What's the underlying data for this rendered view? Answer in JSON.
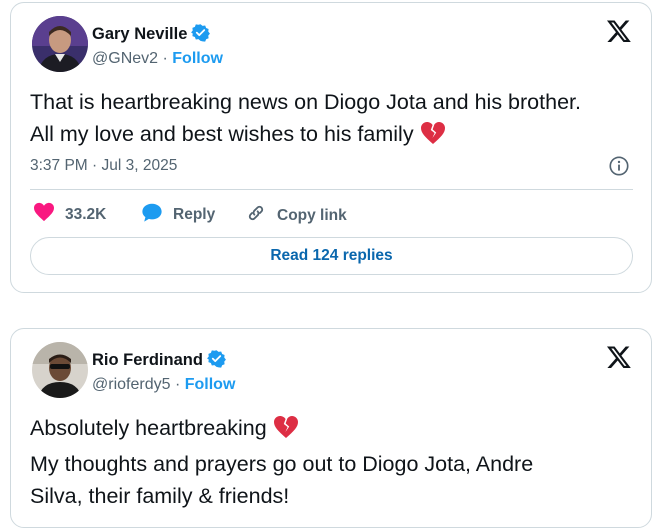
{
  "colors": {
    "accent": "#1d9bf0",
    "like": "#f91880",
    "text": "#0f1419",
    "muted": "#536471",
    "border": "#cfd9de",
    "broken_heart": "#dd2e44"
  },
  "tweets": [
    {
      "author_name": "Gary Neville",
      "handle": "@GNev2",
      "separator": "·",
      "follow_label": "Follow",
      "text_lines": [
        "That is heartbreaking news on Diogo Jota and his brother.",
        "All my love and best wishes to his family"
      ],
      "emoji": "broken-heart",
      "timestamp": "3:37 PM · Jul 3, 2025",
      "likes": "33.2K",
      "reply_label": "Reply",
      "copy_label": "Copy link",
      "read_replies_label": "Read 124 replies",
      "icons": [
        "verified-badge-icon",
        "x-logo-icon",
        "info-icon",
        "heart-icon",
        "reply-bubble-icon",
        "link-icon",
        "broken-heart-icon"
      ]
    },
    {
      "author_name": "Rio Ferdinand",
      "handle": "@rioferdy5",
      "separator": "·",
      "follow_label": "Follow",
      "text_lines": [
        "Absolutely heartbreaking",
        "My thoughts and prayers go out to Diogo Jota, Andre",
        "Silva, their family & friends!"
      ],
      "emoji": "broken-heart",
      "icons": [
        "verified-badge-icon",
        "x-logo-icon",
        "broken-heart-icon"
      ]
    }
  ]
}
